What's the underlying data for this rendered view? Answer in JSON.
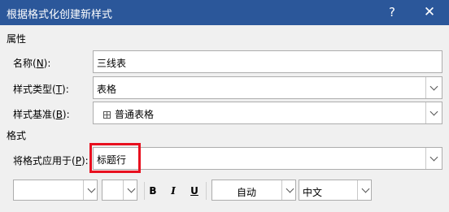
{
  "window": {
    "title": "根据格式化创建新样式",
    "help_label": "?",
    "close_label": "✕"
  },
  "properties": {
    "section_label": "属性",
    "name": {
      "label": "名称(",
      "key": "N",
      "label_end": "):",
      "value": "三线表"
    },
    "style_type": {
      "label": "样式类型(",
      "key": "T",
      "label_end": "):",
      "value": "表格"
    },
    "style_base": {
      "label": "样式基准(",
      "key": "B",
      "label_end": "):",
      "value": "普通表格",
      "icon": "table-grid-icon"
    }
  },
  "format": {
    "section_label": "格式",
    "apply_to": {
      "label": "将格式应用于(",
      "key": "P",
      "label_end": "):",
      "value": "标题行"
    },
    "toolbar": {
      "font_name": "",
      "font_size": "",
      "bold_label": "B",
      "italic_label": "I",
      "underline_label": "U",
      "color_value": "自动",
      "script_value": "中文"
    }
  },
  "colors": {
    "title_bar": "#2b579a",
    "highlight": "#e8101f"
  }
}
